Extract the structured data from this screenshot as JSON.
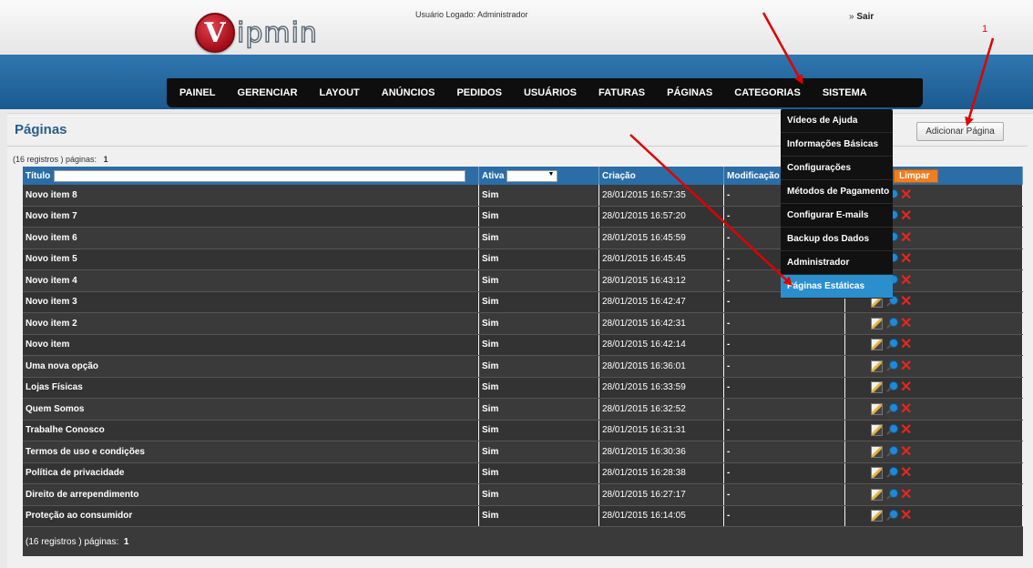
{
  "header": {
    "logo_letter": "V",
    "logo_text": "ipmin",
    "user_logged": "Usuário Logado: Administrador",
    "logout_prefix": "» ",
    "logout_label": "Sair"
  },
  "nav": {
    "items": [
      {
        "label": "PAINEL"
      },
      {
        "label": "GERENCIAR"
      },
      {
        "label": "LAYOUT"
      },
      {
        "label": "ANÚNCIOS"
      },
      {
        "label": "PEDIDOS"
      },
      {
        "label": "USUÁRIOS"
      },
      {
        "label": "FATURAS"
      },
      {
        "label": "PÁGINAS"
      },
      {
        "label": "CATEGORIAS"
      },
      {
        "label": "SISTEMA"
      }
    ]
  },
  "system_menu": {
    "items": [
      {
        "label": "Vídeos de Ajuda"
      },
      {
        "label": "Informações Básicas"
      },
      {
        "label": "Configurações"
      },
      {
        "label": "Métodos de Pagamento"
      },
      {
        "label": "Configurar E-mails"
      },
      {
        "label": "Backup dos Dados"
      },
      {
        "label": "Administrador"
      },
      {
        "label": "Páginas Estáticas"
      }
    ],
    "active_color": "#2b8fce"
  },
  "page": {
    "title": "Páginas",
    "add_button": "Adicionar Página",
    "count_top_prefix": "(16 registros ) páginas:",
    "count_top_pages": "1",
    "count_bottom_prefix": "(16 registros ) páginas:",
    "count_bottom_pages": "1"
  },
  "table": {
    "headers": {
      "title": "Título",
      "active": "Ativa",
      "created": "Criação",
      "modified": "Modificação",
      "clear_button": "Limpar"
    },
    "rows": [
      {
        "title": "Novo item 8",
        "active": "Sim",
        "created": "28/01/2015 16:57:35",
        "modified": "-"
      },
      {
        "title": "Novo item 7",
        "active": "Sim",
        "created": "28/01/2015 16:57:20",
        "modified": "-"
      },
      {
        "title": "Novo item 6",
        "active": "Sim",
        "created": "28/01/2015 16:45:59",
        "modified": "-"
      },
      {
        "title": "Novo item 5",
        "active": "Sim",
        "created": "28/01/2015 16:45:45",
        "modified": "-"
      },
      {
        "title": "Novo item 4",
        "active": "Sim",
        "created": "28/01/2015 16:43:12",
        "modified": "-"
      },
      {
        "title": "Novo item 3",
        "active": "Sim",
        "created": "28/01/2015 16:42:47",
        "modified": "-"
      },
      {
        "title": "Novo item 2",
        "active": "Sim",
        "created": "28/01/2015 16:42:31",
        "modified": "-"
      },
      {
        "title": "Novo item",
        "active": "Sim",
        "created": "28/01/2015 16:42:14",
        "modified": "-"
      },
      {
        "title": "Uma nova opção",
        "active": "Sim",
        "created": "28/01/2015 16:36:01",
        "modified": "-"
      },
      {
        "title": "Lojas Físicas",
        "active": "Sim",
        "created": "28/01/2015 16:33:59",
        "modified": "-"
      },
      {
        "title": "Quem Somos",
        "active": "Sim",
        "created": "28/01/2015 16:32:52",
        "modified": "-"
      },
      {
        "title": "Trabalhe Conosco",
        "active": "Sim",
        "created": "28/01/2015 16:31:31",
        "modified": "-"
      },
      {
        "title": "Termos de uso e condições",
        "active": "Sim",
        "created": "28/01/2015 16:30:36",
        "modified": "-"
      },
      {
        "title": "Política de privacidade",
        "active": "Sim",
        "created": "28/01/2015 16:28:38",
        "modified": "-"
      },
      {
        "title": "Direito de arrependimento",
        "active": "Sim",
        "created": "28/01/2015 16:27:17",
        "modified": "-"
      },
      {
        "title": "Proteção ao consumidor",
        "active": "Sim",
        "created": "28/01/2015 16:14:05",
        "modified": "-"
      }
    ],
    "action_icons": [
      "edit-icon",
      "view-icon",
      "delete-icon"
    ]
  },
  "annotation": {
    "step_number": "1",
    "color": "#e00000"
  },
  "colors": {
    "header_blue": "#2b6ea7",
    "clear_orange": "#f07d1e",
    "row_dark": "#3a3a3a"
  }
}
